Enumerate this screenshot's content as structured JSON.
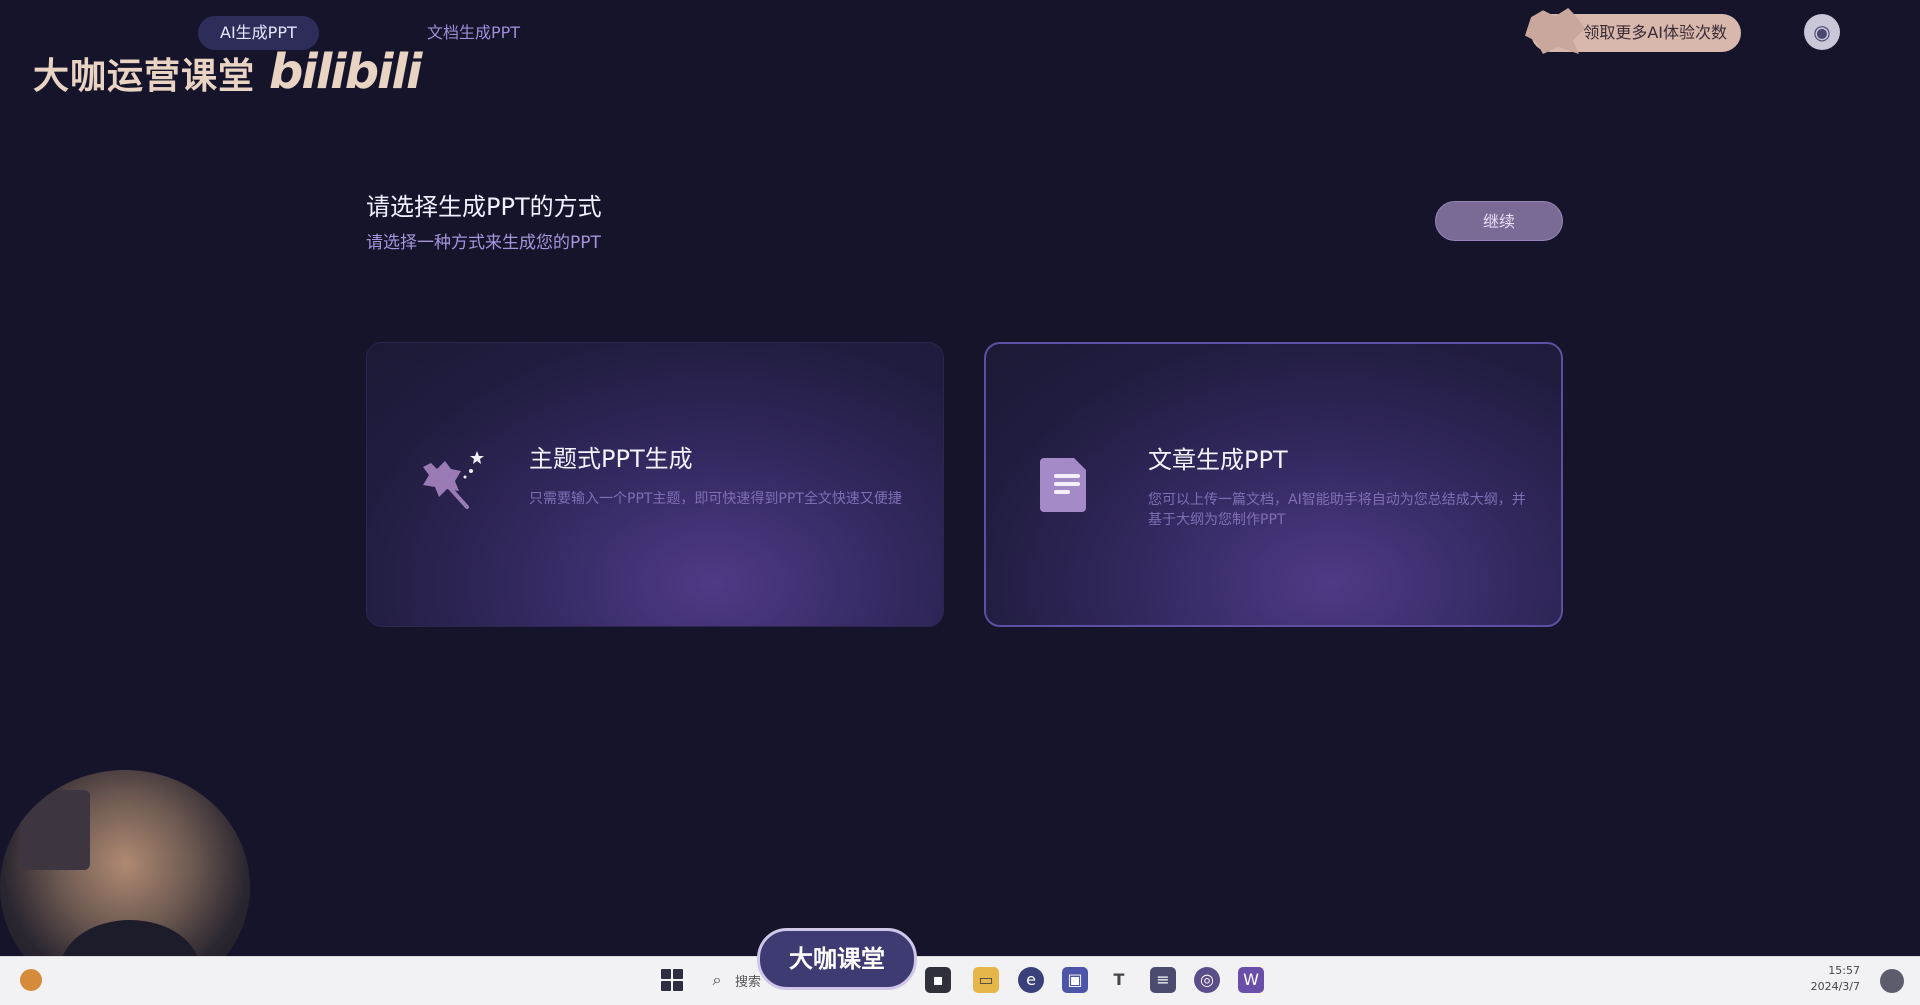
{
  "header": {
    "tabs": [
      {
        "label": "AI生成PPT",
        "active": true
      },
      {
        "label": "文档生成PPT",
        "active": false
      }
    ],
    "promo_label": "领取更多AI体验次数"
  },
  "watermark": {
    "text": "大咖运营课堂",
    "brand": "bilibili"
  },
  "page": {
    "title": "请选择生成PPT的方式",
    "subtitle": "请选择一种方式来生成您的PPT",
    "continue_label": "继续"
  },
  "cards": [
    {
      "title": "主题式PPT生成",
      "description": "只需要输入一个PPT主题，即可快速得到PPT全文快速又便捷",
      "icon": "magic-wand-icon",
      "selected": false
    },
    {
      "title": "文章生成PPT",
      "description": "您可以上传一篇文档，AI智能助手将自动为您总结成大纲，并基于大纲为您制作PPT",
      "icon": "document-icon",
      "selected": true
    }
  ],
  "taskbar": {
    "search_label": "搜索",
    "time": "15:57",
    "date": "2024/3/7",
    "logo_text": "大咖课堂"
  },
  "colors": {
    "background": "#15142a",
    "accent": "#5d4fa1",
    "promo": "#d8b8ad"
  }
}
